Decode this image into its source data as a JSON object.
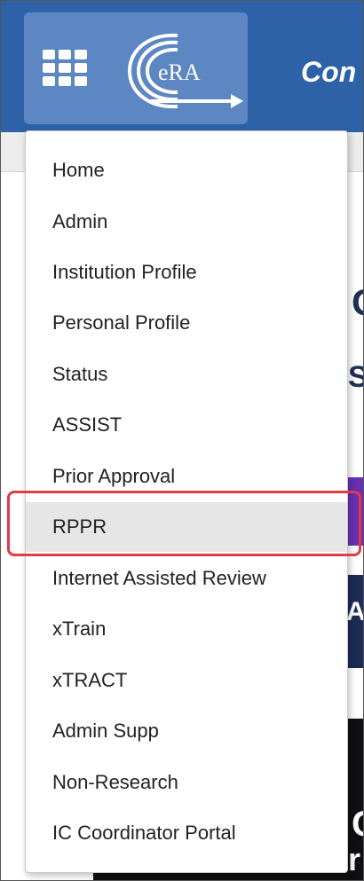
{
  "header": {
    "title": "Con",
    "logo_text": "eRA"
  },
  "background": {
    "peek_1": "C",
    "peek_2": "S",
    "peek_3": "AS",
    "peek_4": "C",
    "peek_5": "r"
  },
  "menu": {
    "items": [
      {
        "label": "Home"
      },
      {
        "label": "Admin"
      },
      {
        "label": "Institution Profile"
      },
      {
        "label": "Personal Profile"
      },
      {
        "label": "Status"
      },
      {
        "label": "ASSIST"
      },
      {
        "label": "Prior Approval"
      },
      {
        "label": "RPPR",
        "highlighted": true
      },
      {
        "label": "Internet Assisted Review"
      },
      {
        "label": "xTrain"
      },
      {
        "label": "xTRACT"
      },
      {
        "label": "Admin Supp"
      },
      {
        "label": "Non-Research"
      },
      {
        "label": "IC Coordinator Portal"
      }
    ]
  },
  "colors": {
    "header_bg": "#2d62a8",
    "header_button_bg": "#5c87c2",
    "highlight_border": "#e23a4a",
    "active_item_bg": "#e6e6e6"
  }
}
